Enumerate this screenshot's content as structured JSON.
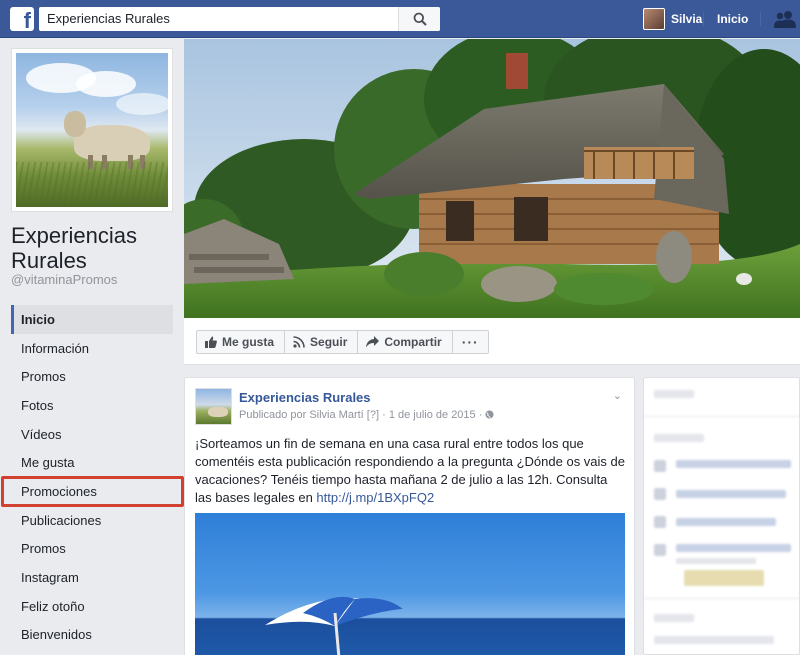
{
  "topbar": {
    "logo": "f",
    "search_value": "Experiencias Rurales",
    "user_name": "Silvia",
    "home_label": "Inicio",
    "icons": {
      "search": "search-icon",
      "friends": "friends-icon"
    }
  },
  "page": {
    "name": "Experiencias Rurales",
    "handle": "@vitaminaPromos"
  },
  "left_nav": {
    "items": [
      {
        "label": "Inicio",
        "active": true
      },
      {
        "label": "Información"
      },
      {
        "label": "Promos"
      },
      {
        "label": "Fotos"
      },
      {
        "label": "Vídeos"
      },
      {
        "label": "Me gusta"
      },
      {
        "label": "Promociones",
        "highlighted": true
      },
      {
        "label": "Publicaciones"
      },
      {
        "label": "Promos"
      },
      {
        "label": "Instagram"
      },
      {
        "label": "Feliz otoño"
      },
      {
        "label": "Bienvenidos"
      }
    ]
  },
  "actions": {
    "like": "Me gusta",
    "follow": "Seguir",
    "share": "Compartir",
    "more": "···"
  },
  "post": {
    "author": "Experiencias Rurales",
    "meta_prefix": "Publicado por Silvia Martí",
    "meta_help": "[?]",
    "meta_date": "· 1 de julio de 2015 ·",
    "text": "¡Sorteamos un fin de semana en una casa rural entre todos los que comentéis esta publicación respondiendo a la pregunta ¿Dónde os vais de vacaciones? Tenéis tiempo hasta mañana 2 de julio a las 12h. Consulta las bases legales en ",
    "link": "http://j.mp/1BXpFQ2"
  },
  "colors": {
    "brand": "#3b5998",
    "link": "#365899",
    "highlight": "#d2412f"
  }
}
